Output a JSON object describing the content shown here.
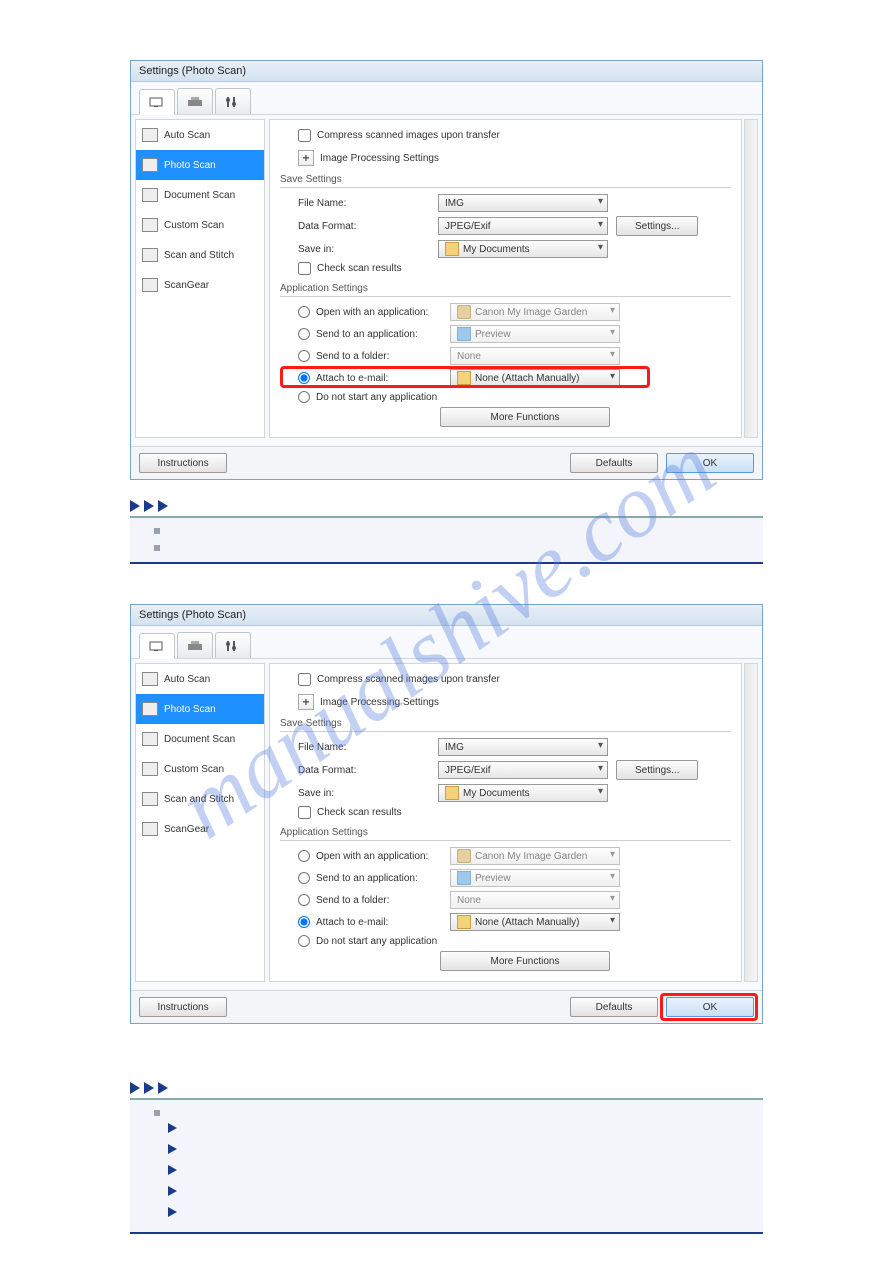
{
  "watermark": "manualshive.com",
  "dialog": {
    "title": "Settings (Photo Scan)",
    "sidebar": [
      {
        "label": "Auto Scan"
      },
      {
        "label": "Photo Scan"
      },
      {
        "label": "Document Scan"
      },
      {
        "label": "Custom Scan"
      },
      {
        "label": "Scan and Stitch"
      },
      {
        "label": "ScanGear"
      }
    ],
    "compress_label": "Compress scanned images upon transfer",
    "ips_label": "Image Processing Settings",
    "sections": {
      "save": "Save Settings",
      "app": "Application Settings"
    },
    "save": {
      "file_name_label": "File Name:",
      "file_name_value": "IMG",
      "data_format_label": "Data Format:",
      "data_format_value": "JPEG/Exif",
      "settings_btn": "Settings...",
      "save_in_label": "Save in:",
      "save_in_value": "My Documents",
      "check_results": "Check scan results"
    },
    "app": {
      "open_label": "Open with an application:",
      "open_value": "Canon My Image Garden",
      "send_app_label": "Send to an application:",
      "send_app_value": "Preview",
      "send_folder_label": "Send to a folder:",
      "send_folder_value": "None",
      "attach_label": "Attach to e-mail:",
      "attach_value": "None (Attach Manually)",
      "nostart_label": "Do not start any application",
      "more_functions": "More Functions"
    },
    "footer": {
      "instructions": "Instructions",
      "defaults": "Defaults",
      "ok": "OK"
    }
  }
}
